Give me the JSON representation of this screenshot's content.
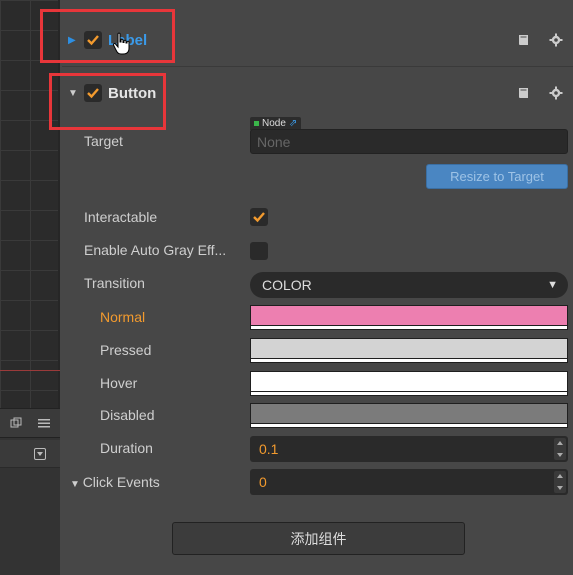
{
  "label_component": {
    "title": "Label",
    "enabled": true
  },
  "button_component": {
    "title": "Button",
    "enabled": true,
    "target": {
      "label": "Target",
      "tag": "Node",
      "value": "None"
    },
    "resize_button": "Resize to Target",
    "interactable": {
      "label": "Interactable",
      "checked": true
    },
    "auto_gray": {
      "label": "Enable Auto Gray Eff...",
      "checked": false
    },
    "transition": {
      "label": "Transition",
      "value": "COLOR"
    },
    "colors": [
      {
        "label": "Normal",
        "color": "#ed7fb0"
      },
      {
        "label": "Pressed",
        "color": "#d3d3d3"
      },
      {
        "label": "Hover",
        "color": "#ffffff"
      },
      {
        "label": "Disabled",
        "color": "#7b7b7b"
      }
    ],
    "duration": {
      "label": "Duration",
      "value": "0.1"
    },
    "click_events": {
      "label": "Click Events",
      "value": "0"
    }
  },
  "add_component_button": "添加组件",
  "accent_colors": {
    "checkbox": "#f29a2e",
    "link": "#3b9ae8",
    "highlight": "#e8363a"
  }
}
